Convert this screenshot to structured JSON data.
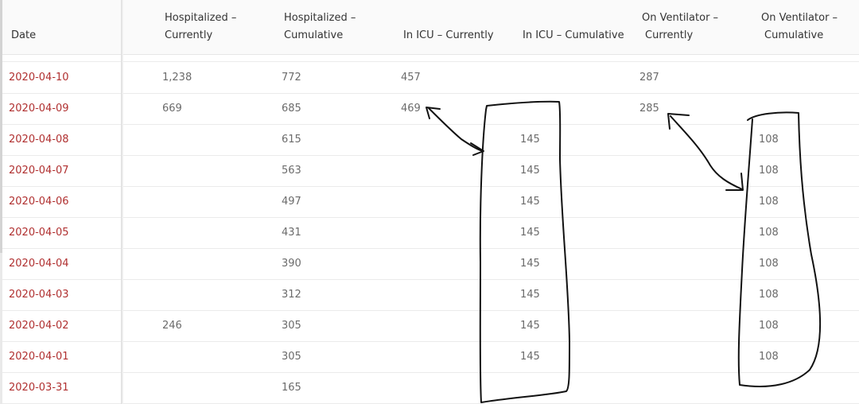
{
  "header": {
    "columns": [
      {
        "line1": "",
        "line2": "Date"
      },
      {
        "line1": "Hospitalized –",
        "line2": "Currently"
      },
      {
        "line1": "Hospitalized –",
        "line2": "Cumulative"
      },
      {
        "line1": "",
        "line2": "In ICU – Currently"
      },
      {
        "line1": "",
        "line2": "In ICU – Cumulative"
      },
      {
        "line1": "On Ventilator –",
        "line2": "Currently"
      },
      {
        "line1": "On Ventilator –",
        "line2": "Cumulative"
      }
    ]
  },
  "rows": [
    {
      "date": "2020-04-10",
      "hosp_current": "1,238",
      "hosp_cumulative": "772",
      "icu_current": "457",
      "icu_cumulative": "",
      "vent_current": "287",
      "vent_cumulative": ""
    },
    {
      "date": "2020-04-09",
      "hosp_current": "669",
      "hosp_cumulative": "685",
      "icu_current": "469",
      "icu_cumulative": "",
      "vent_current": "285",
      "vent_cumulative": ""
    },
    {
      "date": "2020-04-08",
      "hosp_current": "",
      "hosp_cumulative": "615",
      "icu_current": "",
      "icu_cumulative": "145",
      "vent_current": "",
      "vent_cumulative": "108"
    },
    {
      "date": "2020-04-07",
      "hosp_current": "",
      "hosp_cumulative": "563",
      "icu_current": "",
      "icu_cumulative": "145",
      "vent_current": "",
      "vent_cumulative": "108"
    },
    {
      "date": "2020-04-06",
      "hosp_current": "",
      "hosp_cumulative": "497",
      "icu_current": "",
      "icu_cumulative": "145",
      "vent_current": "",
      "vent_cumulative": "108"
    },
    {
      "date": "2020-04-05",
      "hosp_current": "",
      "hosp_cumulative": "431",
      "icu_current": "",
      "icu_cumulative": "145",
      "vent_current": "",
      "vent_cumulative": "108"
    },
    {
      "date": "2020-04-04",
      "hosp_current": "",
      "hosp_cumulative": "390",
      "icu_current": "",
      "icu_cumulative": "145",
      "vent_current": "",
      "vent_cumulative": "108"
    },
    {
      "date": "2020-04-03",
      "hosp_current": "",
      "hosp_cumulative": "312",
      "icu_current": "",
      "icu_cumulative": "145",
      "vent_current": "",
      "vent_cumulative": "108"
    },
    {
      "date": "2020-04-02",
      "hosp_current": "246",
      "hosp_cumulative": "305",
      "icu_current": "",
      "icu_cumulative": "145",
      "vent_current": "",
      "vent_cumulative": "108"
    },
    {
      "date": "2020-04-01",
      "hosp_current": "",
      "hosp_cumulative": "305",
      "icu_current": "",
      "icu_cumulative": "145",
      "vent_current": "",
      "vent_cumulative": "108"
    },
    {
      "date": "2020-03-31",
      "hosp_current": "",
      "hosp_cumulative": "165",
      "icu_current": "",
      "icu_cumulative": "",
      "vent_current": "",
      "vent_cumulative": ""
    }
  ],
  "colors": {
    "date_link": "#b03030",
    "cell_text": "#6b6b6b",
    "header_text": "#333333",
    "annotation_ink": "#111111"
  },
  "annotations": [
    {
      "name": "icu-cumulative-circle",
      "kind": "hand-drawn-loop"
    },
    {
      "name": "vent-cumulative-circle",
      "kind": "hand-drawn-loop"
    },
    {
      "name": "icu-arrow",
      "kind": "hand-drawn-double-arrow"
    },
    {
      "name": "vent-arrow",
      "kind": "hand-drawn-double-arrow"
    }
  ]
}
